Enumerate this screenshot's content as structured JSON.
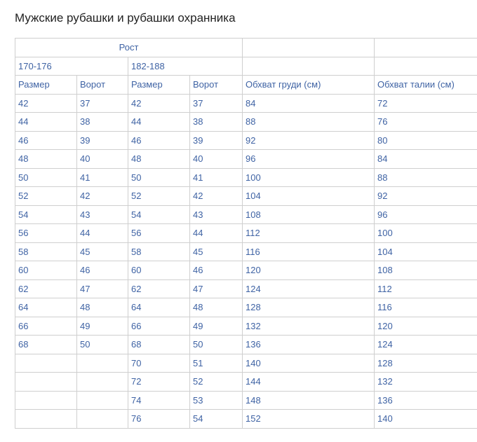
{
  "title": "Мужские рубашки и рубашки охранника",
  "table": {
    "group_header": "Рост",
    "height_ranges": [
      "170-176",
      "182-188"
    ],
    "columns": [
      "Размер",
      "Ворот",
      "Размер",
      "Ворот",
      "Обхват груди (см)",
      "Обхват талии (см)"
    ],
    "rows": [
      [
        "42",
        "37",
        "42",
        "37",
        "84",
        "72"
      ],
      [
        "44",
        "38",
        "44",
        "38",
        "88",
        "76"
      ],
      [
        "46",
        "39",
        "46",
        "39",
        "92",
        "80"
      ],
      [
        "48",
        "40",
        "48",
        "40",
        "96",
        "84"
      ],
      [
        "50",
        "41",
        "50",
        "41",
        "100",
        "88"
      ],
      [
        "52",
        "42",
        "52",
        "42",
        "104",
        "92"
      ],
      [
        "54",
        "43",
        "54",
        "43",
        "108",
        "96"
      ],
      [
        "56",
        "44",
        "56",
        "44",
        "112",
        "100"
      ],
      [
        "58",
        "45",
        "58",
        "45",
        "116",
        "104"
      ],
      [
        "60",
        "46",
        "60",
        "46",
        "120",
        "108"
      ],
      [
        "62",
        "47",
        "62",
        "47",
        "124",
        "112"
      ],
      [
        "64",
        "48",
        "64",
        "48",
        "128",
        "116"
      ],
      [
        "66",
        "49",
        "66",
        "49",
        "132",
        "120"
      ],
      [
        "68",
        "50",
        "68",
        "50",
        "136",
        "124"
      ],
      [
        "",
        "",
        "70",
        "51",
        "140",
        "128"
      ],
      [
        "",
        "",
        "72",
        "52",
        "144",
        "132"
      ],
      [
        "",
        "",
        "74",
        "53",
        "148",
        "136"
      ],
      [
        "",
        "",
        "76",
        "54",
        "152",
        "140"
      ]
    ]
  },
  "colors": {
    "text": "#3f63a4",
    "title": "#222222",
    "border": "#cfcfcf"
  }
}
